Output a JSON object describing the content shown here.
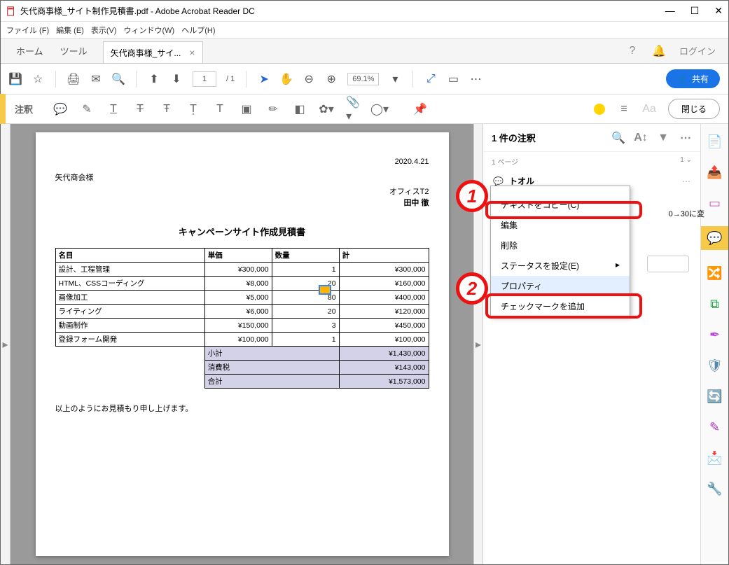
{
  "window": {
    "title": "矢代商事様_サイト制作見積書.pdf - Adobe Acrobat Reader DC"
  },
  "menu": [
    "ファイル (F)",
    "編集 (E)",
    "表示(V)",
    "ウィンドウ(W)",
    "ヘルプ(H)"
  ],
  "tabs": {
    "home": "ホーム",
    "tools": "ツール",
    "doc": "矢代商事様_サイ..."
  },
  "topright": {
    "login": "ログイン"
  },
  "toolbar": {
    "page_current": "1",
    "page_total": "/ 1",
    "zoom": "69.1%",
    "share": "共有"
  },
  "annobar": {
    "label": "注釈",
    "close": "閉じる"
  },
  "comment_panel": {
    "header": "1 件の注釈",
    "page_label": "1 ページ",
    "page_count": "1",
    "author": "トオル",
    "side_text": "0→30に変",
    "menu": {
      "copy": "テキストをコピー(C)",
      "edit": "編集",
      "delete": "削除",
      "status": "ステータスを設定(E)",
      "properties": "プロパティ",
      "checkmark": "チェックマークを追加"
    }
  },
  "document": {
    "date": "2020.4.21",
    "client": "矢代商会様",
    "company": "オフィスT2",
    "author": "田中 徹",
    "title": "キャンペーンサイト作成見積書",
    "headers": {
      "name": "名目",
      "unit": "単価",
      "qty": "数量",
      "total": "計"
    },
    "rows": [
      {
        "name": "設計、工程管理",
        "unit": "¥300,000",
        "qty": "1",
        "total": "¥300,000"
      },
      {
        "name": "HTML、CSSコーディング",
        "unit": "¥8,000",
        "qty": "20",
        "total": "¥160,000"
      },
      {
        "name": "画像加工",
        "unit": "¥5,000",
        "qty": "80",
        "total": "¥400,000"
      },
      {
        "name": "ライティング",
        "unit": "¥6,000",
        "qty": "20",
        "total": "¥120,000"
      },
      {
        "name": "動画制作",
        "unit": "¥150,000",
        "qty": "3",
        "total": "¥450,000"
      },
      {
        "name": "登録フォーム開発",
        "unit": "¥100,000",
        "qty": "1",
        "total": "¥100,000"
      }
    ],
    "summary": {
      "subtotal_l": "小計",
      "subtotal_v": "¥1,430,000",
      "tax_l": "消費税",
      "tax_v": "¥143,000",
      "total_l": "合計",
      "total_v": "¥1,573,000"
    },
    "footnote": "以上のようにお見積もり申し上げます。"
  },
  "callouts": {
    "n1": "1",
    "n2": "2"
  }
}
